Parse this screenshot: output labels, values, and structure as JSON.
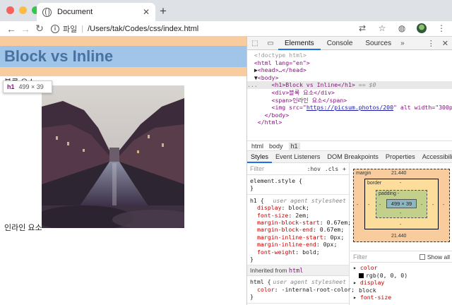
{
  "browser": {
    "tab_title": "Document",
    "new_tab": "+",
    "tab_close": "✕",
    "url_scheme": "파일",
    "url_sep": "|",
    "url_path": "/Users/tak/Codes/css/index.html",
    "info_icon": "i"
  },
  "page": {
    "h1_text": "Block vs Inline",
    "block_text": "블록 요소",
    "inline_text": "인라인 요소",
    "tooltip_tag": "h1",
    "tooltip_size": "499 × 39",
    "highlight_colors": {
      "margin": "#f8cc9e",
      "content": "#a0c5e8"
    }
  },
  "devtools": {
    "tabs": [
      "Elements",
      "Console",
      "Sources"
    ],
    "active_tab": "Elements",
    "more_tabs": "»",
    "dom": {
      "doctype": "<!doctype html>",
      "html_open": "<html lang=\"en\">",
      "head": "<head>…</head>",
      "body_open": "<body>",
      "ellipsis": "...",
      "h1_line": "<h1>Block vs Inline</h1>",
      "selected_marker": "== $0",
      "div_line": "<div>블록 요소</div>",
      "span_line": "<span>인라인 요소</span>",
      "img_open": "<img src=\"",
      "img_src": "https://picsum.photos/200",
      "img_rest": "\" alt width=\"300px\">",
      "body_close": "</body>",
      "html_close": "</html>"
    },
    "breadcrumbs": [
      "html",
      "body",
      "h1"
    ],
    "subtabs": [
      "Styles",
      "Event Listeners",
      "DOM Breakpoints",
      "Properties",
      "Accessibility"
    ],
    "active_subtab": "Styles",
    "styles": {
      "filter_placeholder": "Filter",
      "hov": ":hov",
      "cls": ".cls",
      "add": "+",
      "element_style": "element.style {",
      "close_brace": "}",
      "h1_rule_selector": "h1 {",
      "ua_origin": "user agent stylesheet",
      "h1_decls": [
        {
          "name": "display",
          "value": "block;"
        },
        {
          "name": "font-size",
          "value": "2em;"
        },
        {
          "name": "margin-block-start",
          "value": "0.67em;"
        },
        {
          "name": "margin-block-end",
          "value": "0.67em;"
        },
        {
          "name": "margin-inline-start",
          "value": "0px;"
        },
        {
          "name": "margin-inline-end",
          "value": "0px;"
        },
        {
          "name": "font-weight",
          "value": "bold;"
        }
      ],
      "inherited_label": "Inherited from",
      "inherited_tag": "html",
      "html_rule_selector": "html {",
      "html_decl": {
        "name": "color",
        "value": "-internal-root-color;"
      }
    },
    "boxmodel": {
      "margin_label": "margin",
      "margin_top": "21.440",
      "margin_bottom": "21.440",
      "border_label": "border",
      "padding_label": "padding -",
      "content_size": "499 × 39",
      "dash": "-"
    },
    "computed": {
      "filter_placeholder": "Filter",
      "show_all": "Show all",
      "props": [
        {
          "name": "color",
          "value": "rgb(0, 0, 0)"
        },
        {
          "name": "display",
          "value": "block"
        },
        {
          "name": "font-size",
          "value": ""
        }
      ]
    }
  }
}
